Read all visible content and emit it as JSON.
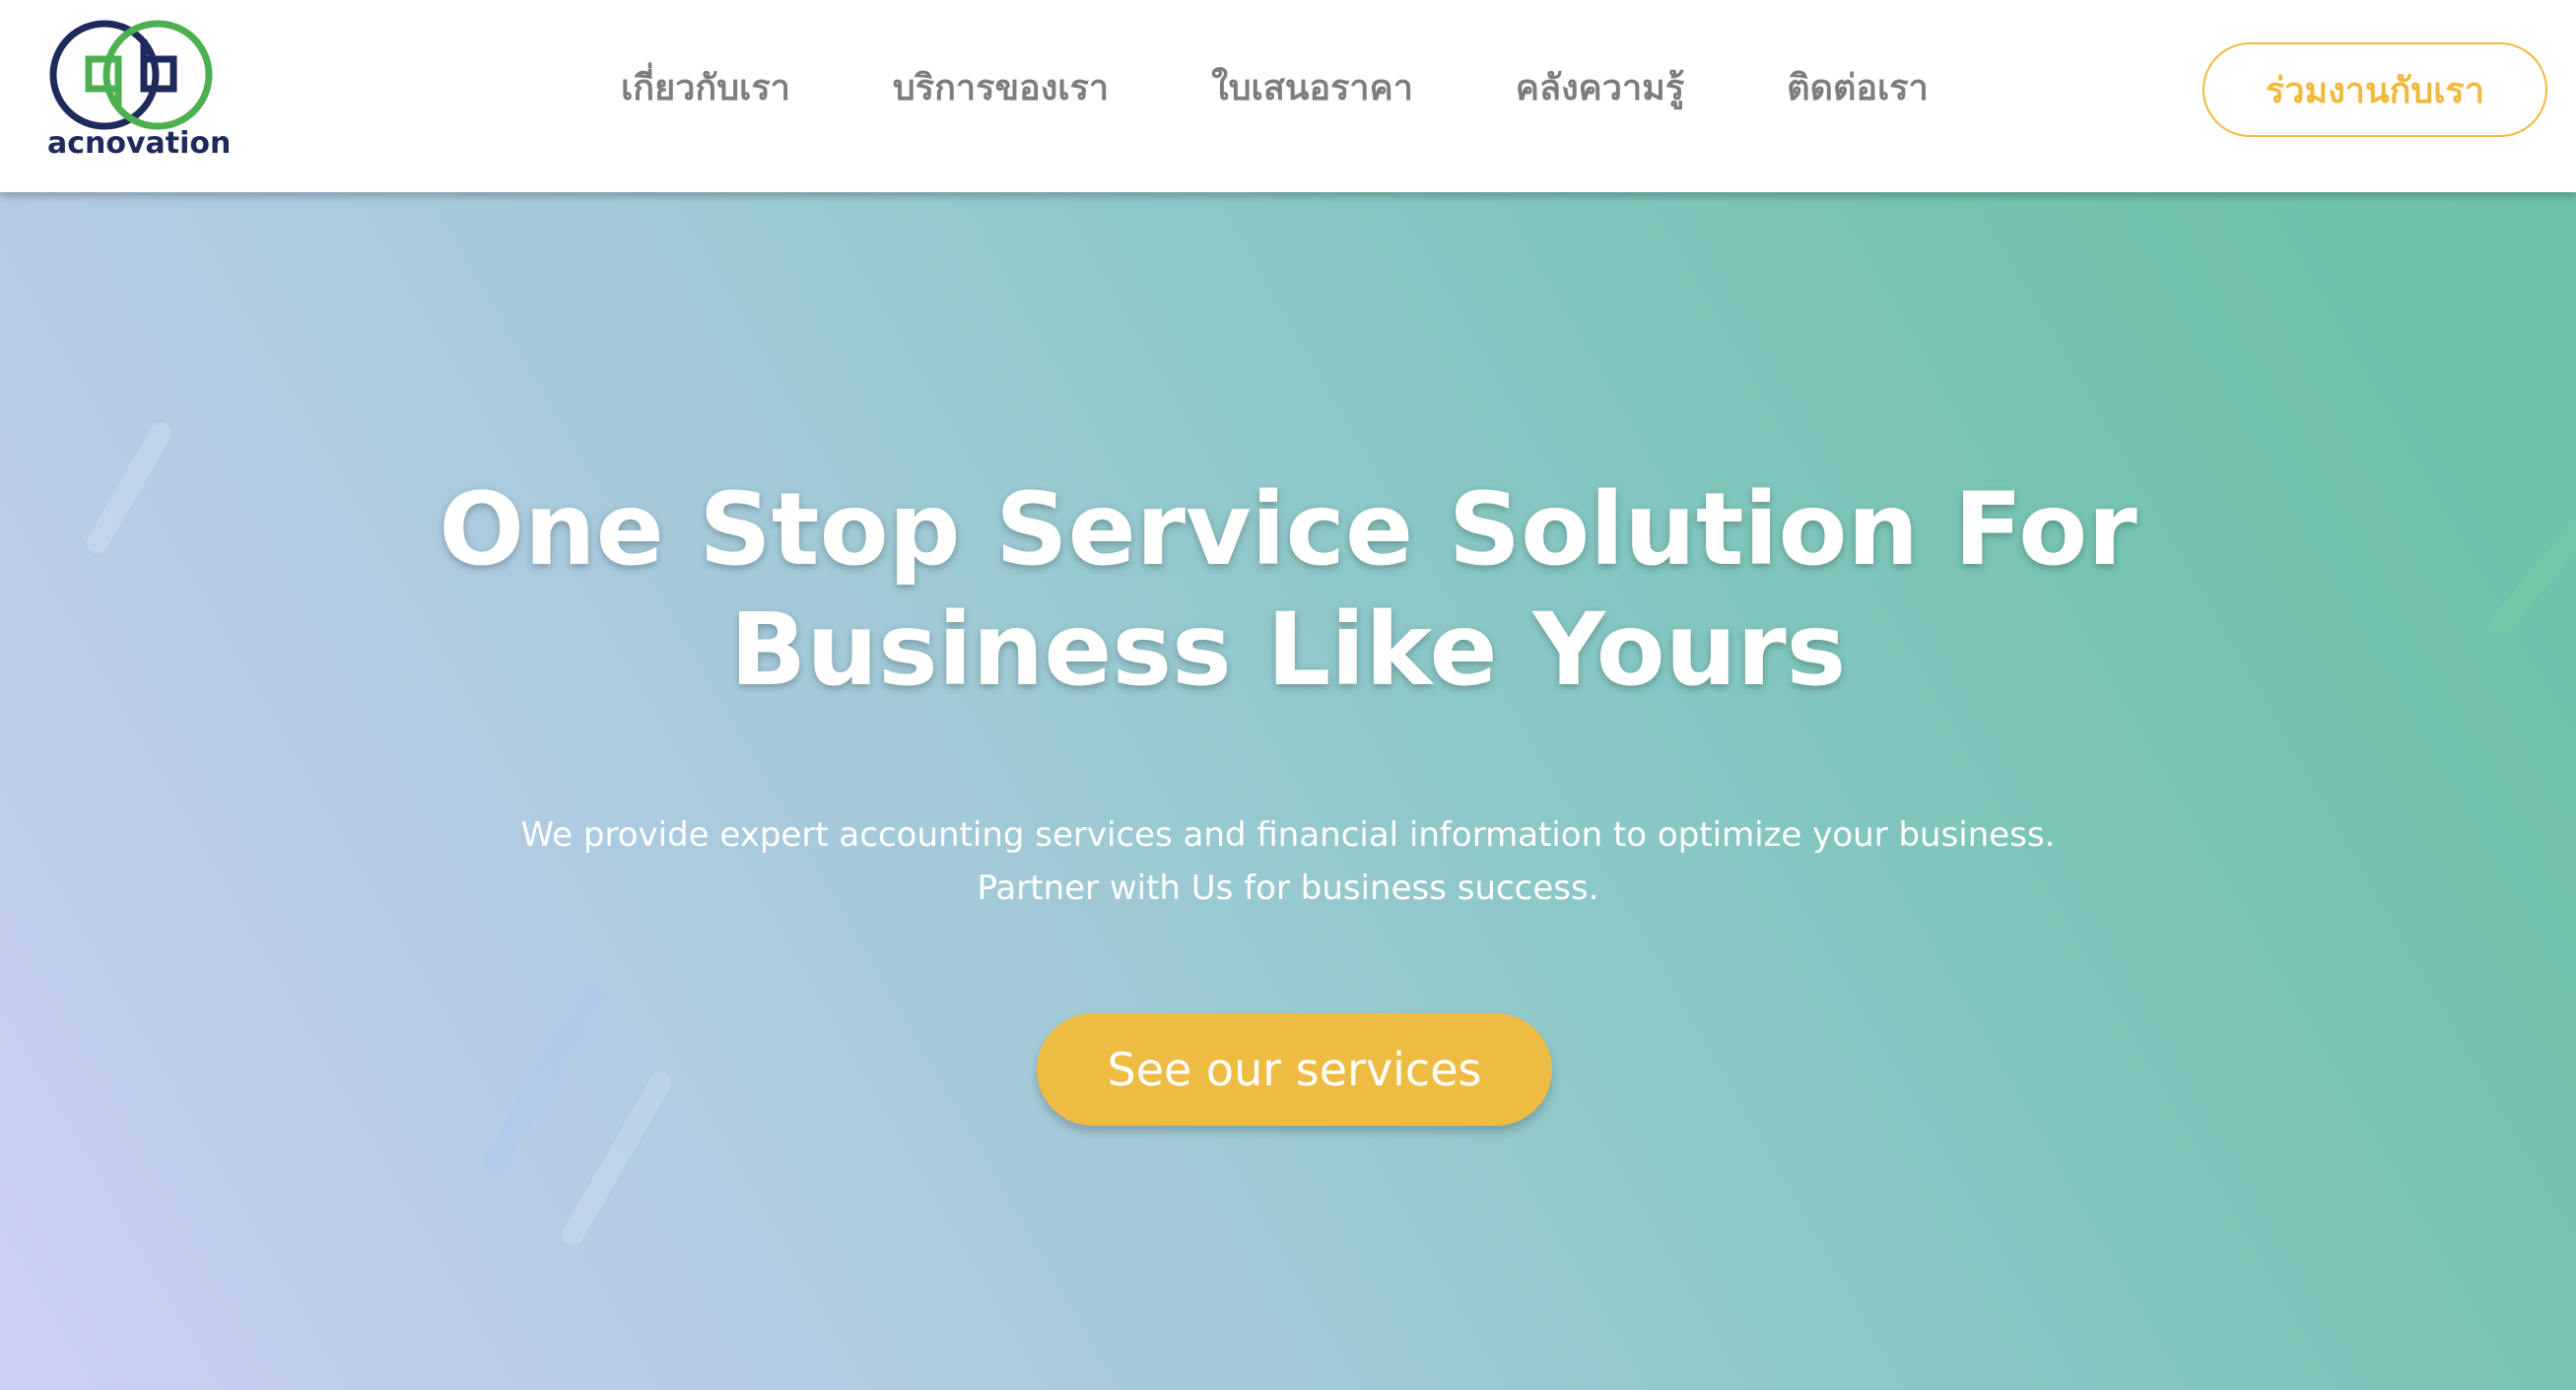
{
  "header": {
    "logo_text": "acnovation",
    "nav": [
      {
        "label": "เกี่ยวกับเรา"
      },
      {
        "label": "บริการของเรา"
      },
      {
        "label": "ใบเสนอราคา"
      },
      {
        "label": "คลังความรู้"
      },
      {
        "label": "ติดต่อเรา"
      }
    ],
    "join_button": "ร่วมงานกับเรา"
  },
  "hero": {
    "title_line1": "One Stop Service Solution For",
    "title_line2": "Business Like Yours",
    "subtitle_line1": "We provide expert accounting services and financial information to optimize your business.",
    "subtitle_line2": "Partner with Us for business success.",
    "cta": "See our services"
  },
  "colors": {
    "accent": "#efbc43",
    "logo_navy": "#1f2a5c",
    "logo_green": "#4caf50",
    "nav_text": "#7d7d7d",
    "hero_gradient_start": "#ccd0f5",
    "hero_gradient_end": "#6dc2ab"
  },
  "icons": {
    "logo": "acnovation-logo-icon"
  }
}
